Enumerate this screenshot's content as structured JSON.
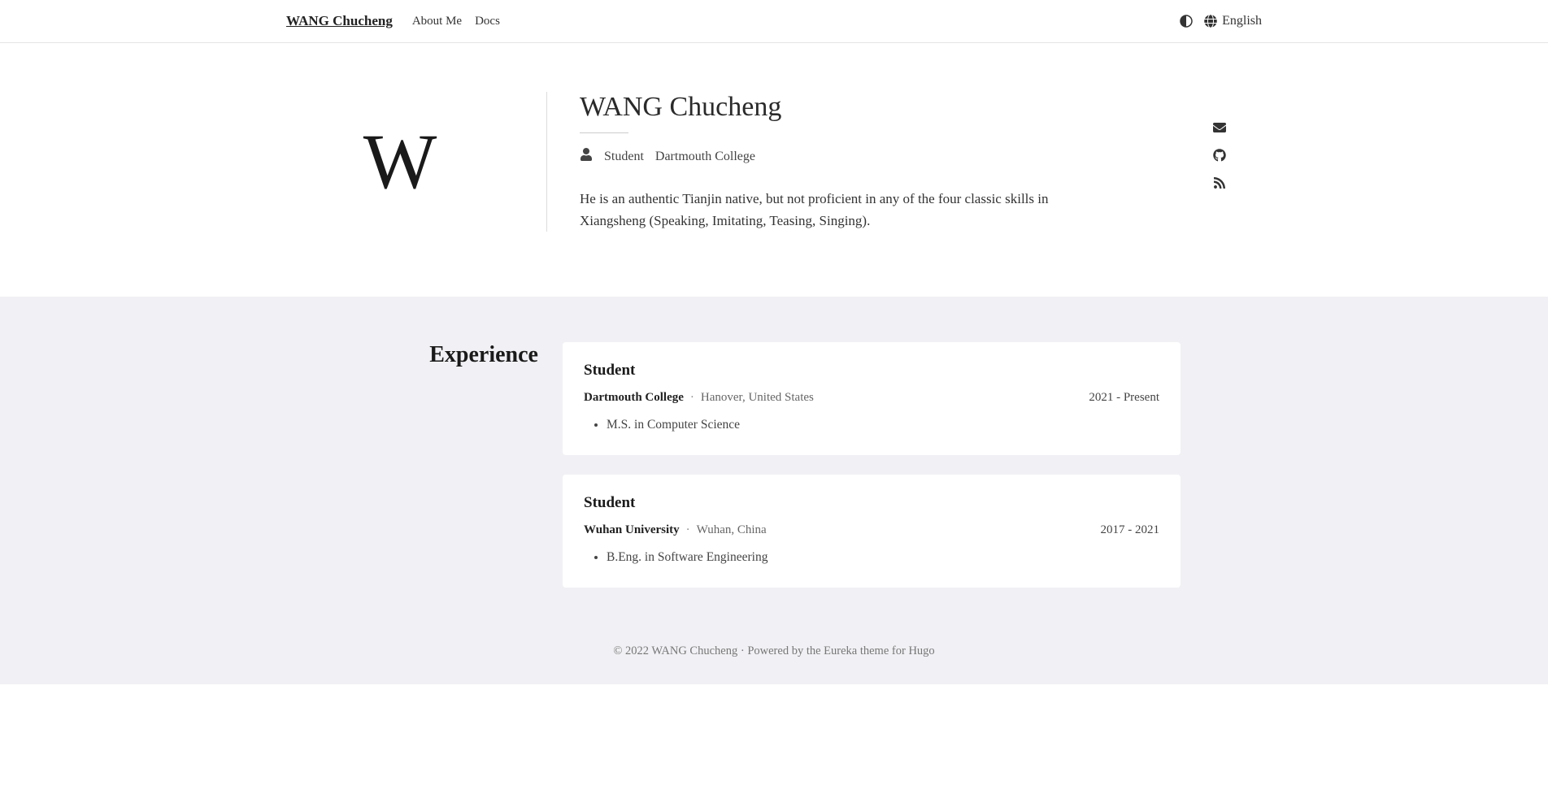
{
  "header": {
    "site_title": "WANG Chucheng",
    "nav": [
      {
        "label": "About Me"
      },
      {
        "label": "Docs"
      }
    ],
    "language_label": "English"
  },
  "intro": {
    "avatar_letter": "W",
    "name": "WANG Chucheng",
    "role": "Student",
    "institution": "Dartmouth College",
    "description": "He is an authentic Tianjin native, but not proficient in any of the four classic skills in Xiangsheng (Speaking, Imitating, Teasing, Singing).",
    "social_icons": [
      "email-icon",
      "github-icon",
      "rss-icon"
    ]
  },
  "experience": {
    "section_title": "Experience",
    "items": [
      {
        "title": "Student",
        "organization": "Dartmouth College",
        "location": "Hanover, United States",
        "period": "2021 - Present",
        "bullets": [
          "M.S. in Computer Science"
        ]
      },
      {
        "title": "Student",
        "organization": "Wuhan University",
        "location": "Wuhan, China",
        "period": "2017 - 2021",
        "bullets": [
          "B.Eng. in Software Engineering"
        ]
      }
    ]
  },
  "footer": {
    "copyright": "© 2022 WANG Chucheng",
    "separator": " · ",
    "powered_prefix": "Powered by the ",
    "theme_name": "Eureka",
    "powered_middle": " theme for ",
    "engine_name": "Hugo"
  }
}
